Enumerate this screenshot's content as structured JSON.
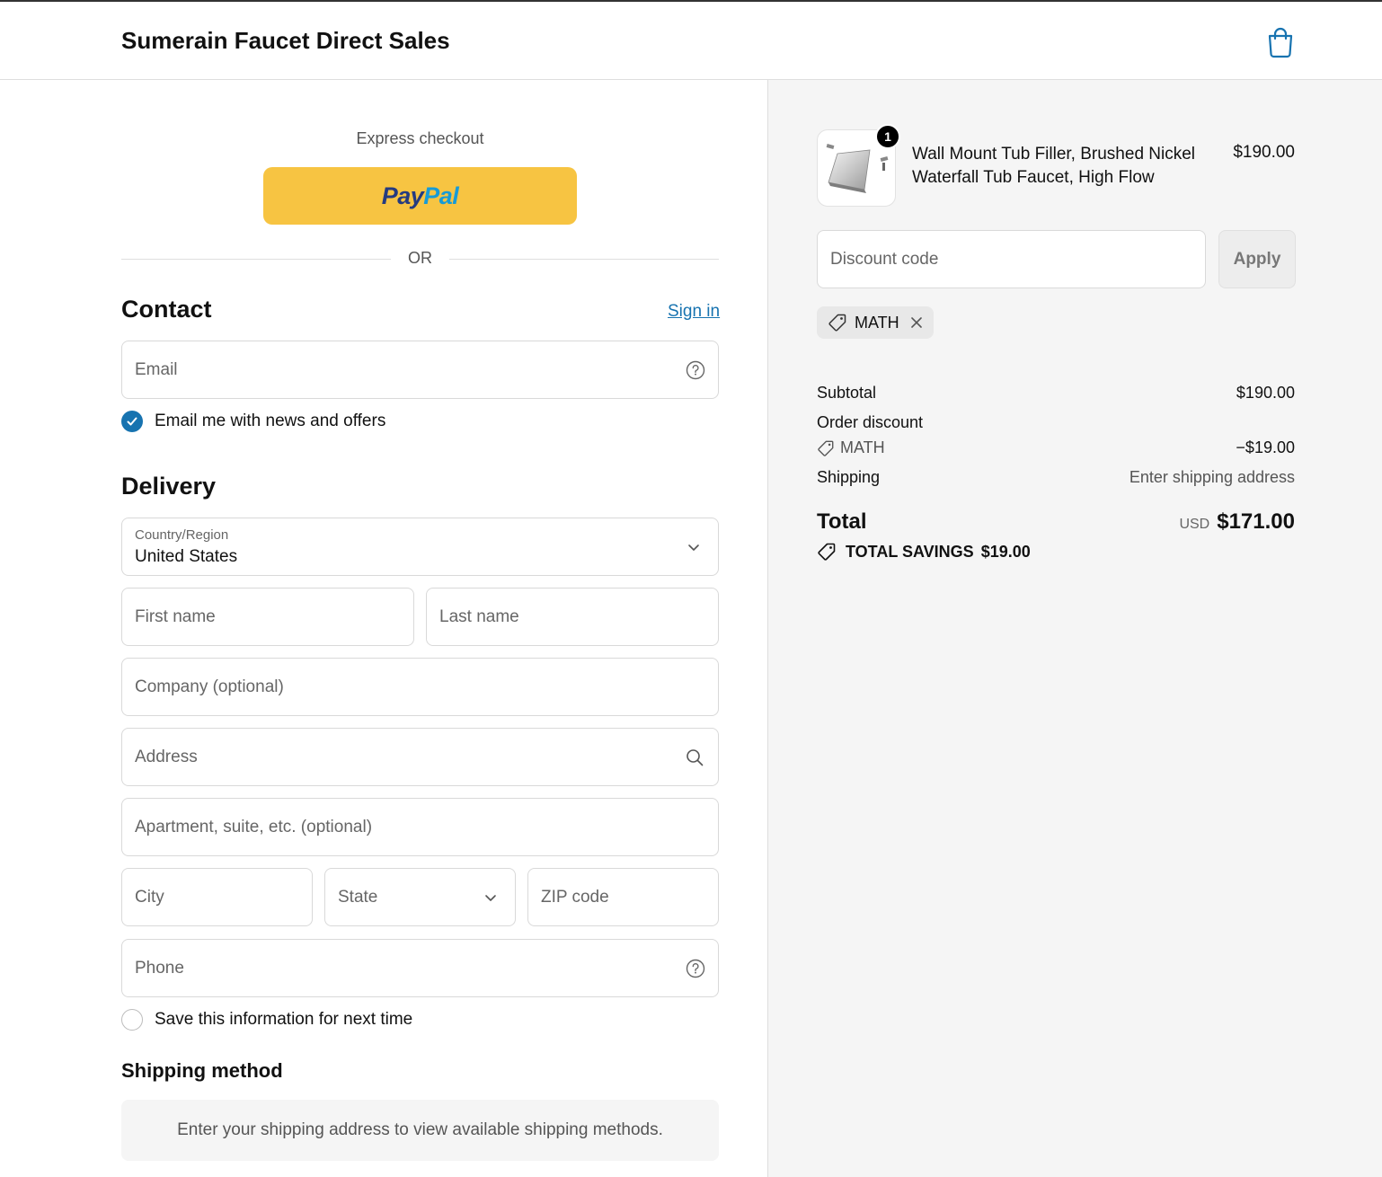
{
  "header": {
    "store_name": "Sumerain Faucet Direct Sales",
    "cart_icon": "shopping-bag-icon"
  },
  "express": {
    "label": "Express checkout",
    "paypal_pay": "Pay",
    "paypal_pal": "Pal",
    "or_text": "OR"
  },
  "contact": {
    "title": "Contact",
    "sign_in": "Sign in",
    "email_placeholder": "Email",
    "newsletter_label": "Email me with news and offers",
    "newsletter_checked": true
  },
  "delivery": {
    "title": "Delivery",
    "country_label": "Country/Region",
    "country_value": "United States",
    "first_name": "First name",
    "last_name": "Last name",
    "company": "Company (optional)",
    "address": "Address",
    "apartment": "Apartment, suite, etc. (optional)",
    "city": "City",
    "state": "State",
    "zip": "ZIP code",
    "phone": "Phone",
    "save_info_label": "Save this information for next time",
    "save_info_checked": false
  },
  "shipping_method": {
    "title": "Shipping method",
    "message": "Enter your shipping address to view available shipping methods."
  },
  "order": {
    "item": {
      "quantity": "1",
      "name": "Wall Mount Tub Filler, Brushed Nickel Waterfall Tub Faucet, High Flow",
      "price": "$190.00"
    },
    "discount_placeholder": "Discount code",
    "apply_label": "Apply",
    "applied_code": "MATH",
    "subtotal_label": "Subtotal",
    "subtotal_value": "$190.00",
    "order_discount_label": "Order discount",
    "discount_code": "MATH",
    "discount_value": "−$19.00",
    "shipping_label": "Shipping",
    "shipping_value": "Enter shipping address",
    "total_label": "Total",
    "currency": "USD",
    "total_value": "$171.00",
    "savings_label": "TOTAL SAVINGS",
    "savings_value": "$19.00"
  },
  "colors": {
    "accent": "#1773b0",
    "paypal_yellow": "#f7c442",
    "paypal_dark": "#253b80",
    "paypal_light": "#179bd7"
  }
}
